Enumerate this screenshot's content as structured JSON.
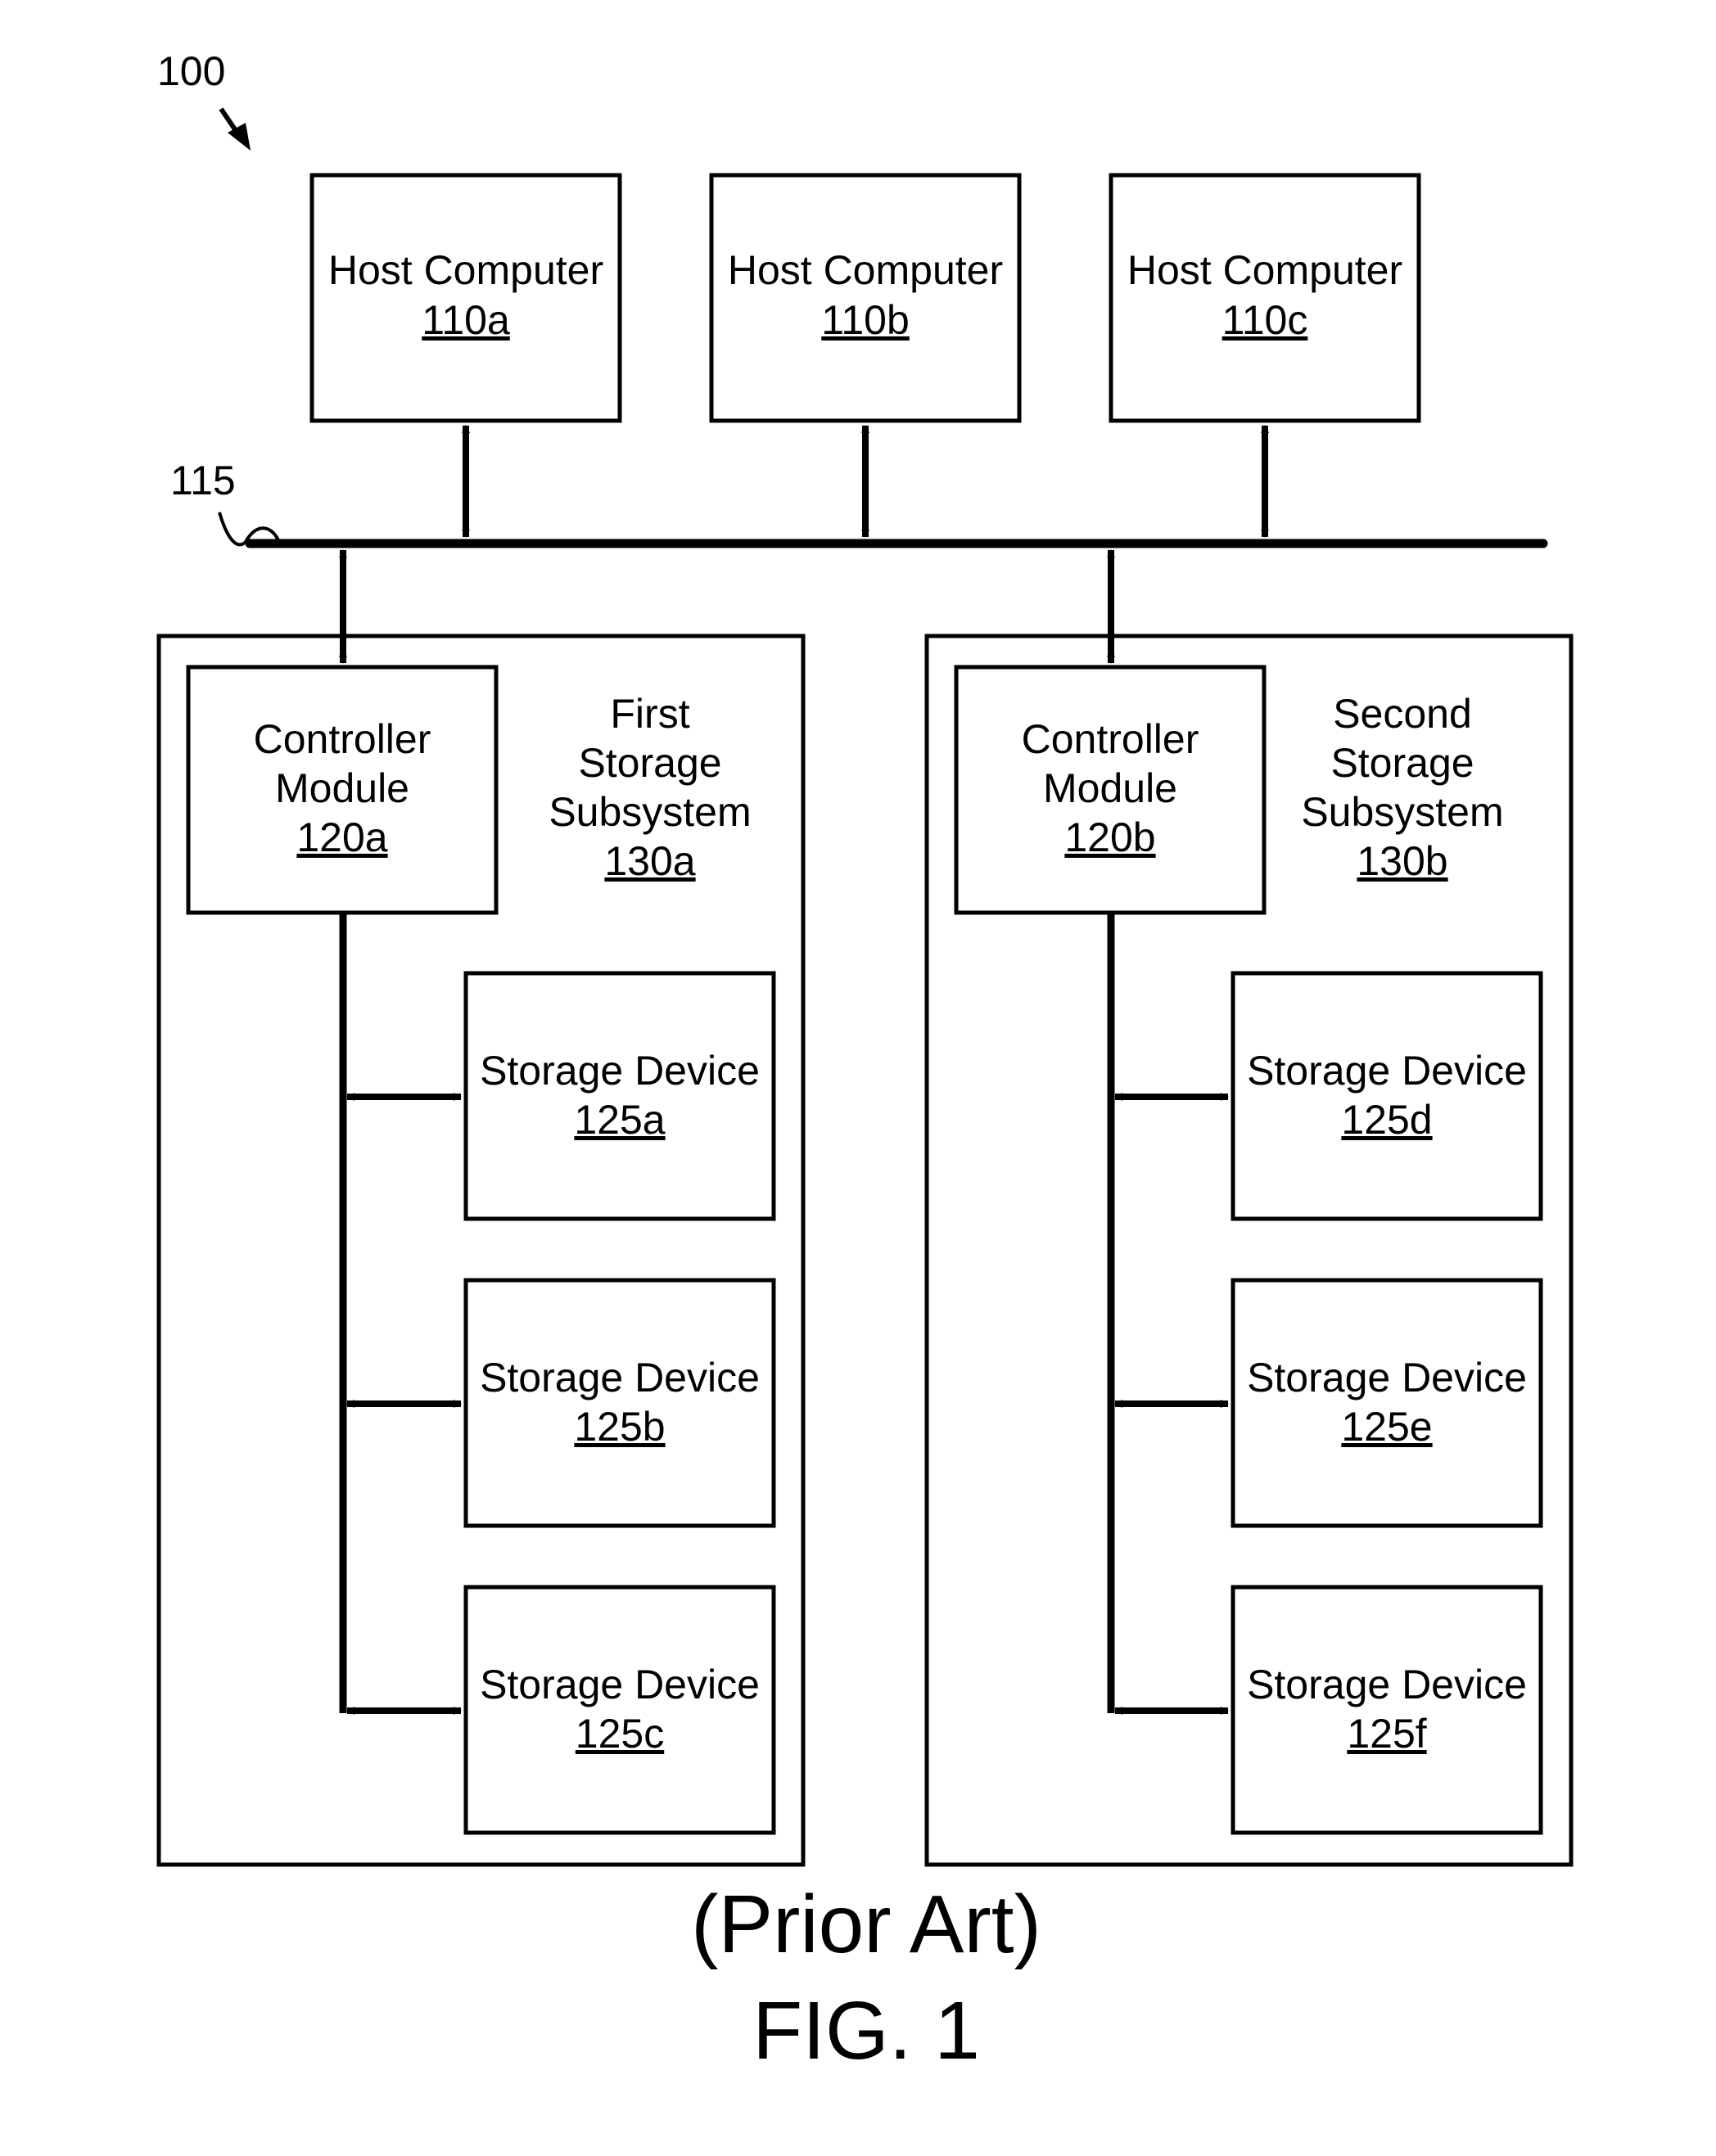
{
  "figure": {
    "ref_system": "100",
    "ref_bus": "115",
    "caption_prior_art": "(Prior Art)",
    "caption_fig": "FIG. 1"
  },
  "hosts": [
    {
      "label": "Host Computer",
      "ref": "110a"
    },
    {
      "label": "Host Computer",
      "ref": "110b"
    },
    {
      "label": "Host Computer",
      "ref": "110c"
    }
  ],
  "subsystems": [
    {
      "label_lines": [
        "First",
        "Storage",
        "Subsystem"
      ],
      "ref": "130a",
      "controller": {
        "label_lines": [
          "Controller",
          "Module"
        ],
        "ref": "120a"
      },
      "devices": [
        {
          "label": "Storage Device",
          "ref": "125a"
        },
        {
          "label": "Storage Device",
          "ref": "125b"
        },
        {
          "label": "Storage Device",
          "ref": "125c"
        }
      ]
    },
    {
      "label_lines": [
        "Second",
        "Storage",
        "Subsystem"
      ],
      "ref": "130b",
      "controller": {
        "label_lines": [
          "Controller",
          "Module"
        ],
        "ref": "120b"
      },
      "devices": [
        {
          "label": "Storage Device",
          "ref": "125d"
        },
        {
          "label": "Storage Device",
          "ref": "125e"
        },
        {
          "label": "Storage Device",
          "ref": "125f"
        }
      ]
    }
  ]
}
